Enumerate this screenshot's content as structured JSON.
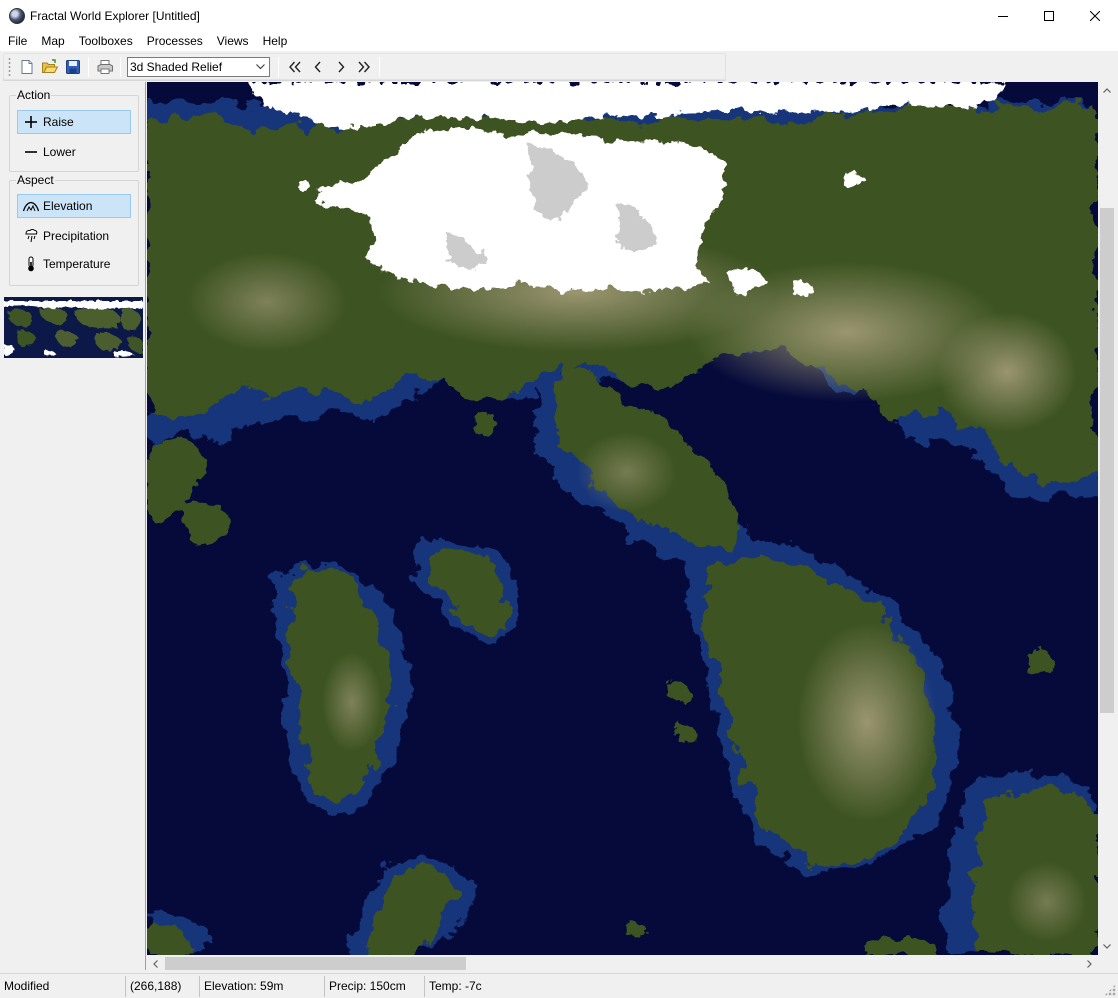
{
  "window": {
    "title": "Fractal World Explorer [Untitled]",
    "app_icon": "globe-icon",
    "controls": [
      "minimize-icon",
      "maximize-icon",
      "close-icon"
    ]
  },
  "menu": [
    "File",
    "Map",
    "Toolboxes",
    "Processes",
    "Views",
    "Help"
  ],
  "toolbar": {
    "buttons": [
      "new-document-icon",
      "open-folder-icon",
      "save-disk-icon",
      "print-icon"
    ],
    "view_mode": "3d Shaded Relief",
    "nav": [
      "first-page-icon",
      "previous-icon",
      "next-icon",
      "last-page-icon"
    ]
  },
  "panel": {
    "action": {
      "label": "Action",
      "raise": "Raise",
      "lower": "Lower"
    },
    "aspect": {
      "label": "Aspect",
      "elevation": "Elevation",
      "precipitation": "Precipitation",
      "temperature": "Temperature"
    },
    "selected": [
      "Raise",
      "Elevation"
    ]
  },
  "map": {
    "colors": {
      "deep_ocean": "#050a3b",
      "shallow_ocean": "#1a3f7e",
      "lowland": "#3f5421",
      "highland": "#8a8660",
      "snow": "#ffffff"
    }
  },
  "status": {
    "state": "Modified",
    "coords": "(266,188)",
    "elevation": "Elevation: 59m",
    "precip": "Precip: 150cm",
    "temp": "Temp: -7c"
  }
}
